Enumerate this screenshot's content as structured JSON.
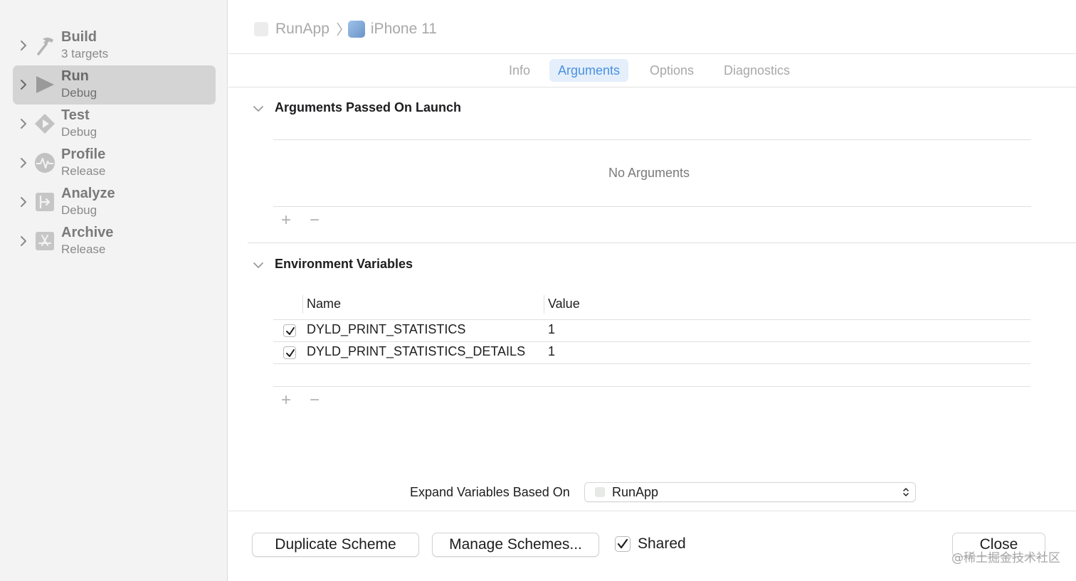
{
  "sidebar": {
    "items": [
      {
        "title": "Build",
        "subtitle": "3 targets",
        "icon": "hammer-icon",
        "selected": false
      },
      {
        "title": "Run",
        "subtitle": "Debug",
        "icon": "play-icon",
        "selected": true
      },
      {
        "title": "Test",
        "subtitle": "Debug",
        "icon": "test-diamond-icon",
        "selected": false
      },
      {
        "title": "Profile",
        "subtitle": "Release",
        "icon": "waveform-icon",
        "selected": false
      },
      {
        "title": "Analyze",
        "subtitle": "Debug",
        "icon": "analyze-icon",
        "selected": false
      },
      {
        "title": "Archive",
        "subtitle": "Release",
        "icon": "app-store-icon",
        "selected": false
      }
    ]
  },
  "breadcrumb": {
    "scheme": "RunApp",
    "device": "iPhone 11"
  },
  "tabs": {
    "items": [
      {
        "label": "Info",
        "active": false
      },
      {
        "label": "Arguments",
        "active": true
      },
      {
        "label": "Options",
        "active": false
      },
      {
        "label": "Diagnostics",
        "active": false
      }
    ]
  },
  "arguments": {
    "title": "Arguments Passed On Launch",
    "empty_text": "No Arguments",
    "add_label": "+",
    "remove_label": "−"
  },
  "environment": {
    "title": "Environment Variables",
    "columns": {
      "name": "Name",
      "value": "Value"
    },
    "rows": [
      {
        "enabled": true,
        "name": "DYLD_PRINT_STATISTICS",
        "value": "1"
      },
      {
        "enabled": true,
        "name": "DYLD_PRINT_STATISTICS_DETAILS",
        "value": "1"
      }
    ],
    "add_label": "+",
    "remove_label": "−"
  },
  "expand": {
    "label": "Expand Variables Based On",
    "selected": "RunApp"
  },
  "footer": {
    "duplicate_label": "Duplicate Scheme",
    "manage_label": "Manage Schemes...",
    "shared_label": "Shared",
    "shared_checked": true,
    "close_label": "Close"
  },
  "watermark": "@稀土掘金技术社区",
  "colors": {
    "accent": "#4a90e2",
    "sidebar_bg": "#f3f3f3",
    "selection_bg": "#d4d4d4"
  }
}
